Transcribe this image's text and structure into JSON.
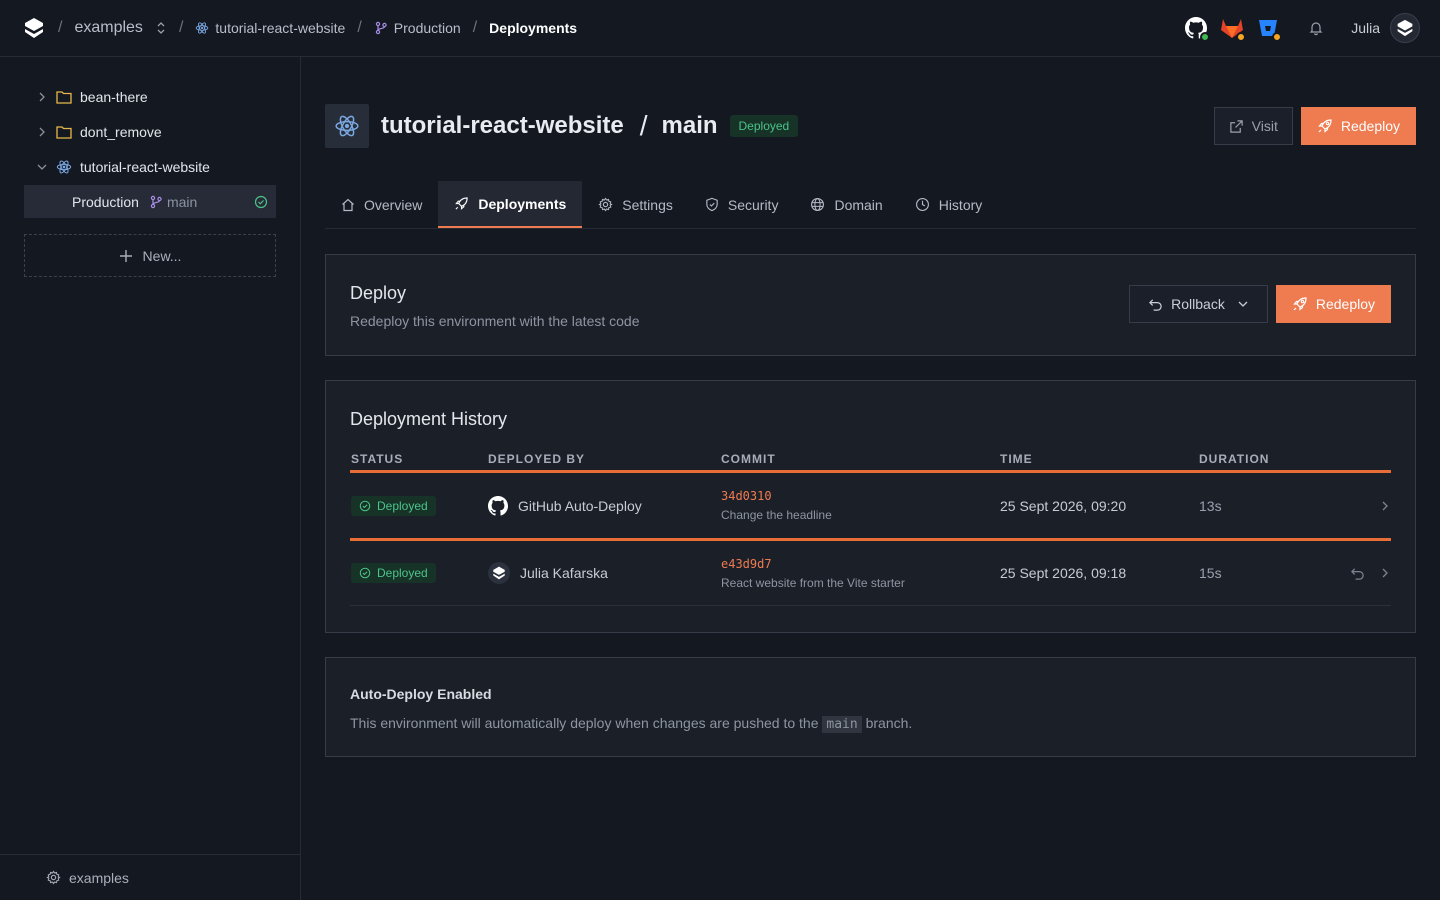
{
  "topbar": {
    "org": "examples",
    "project": "tutorial-react-website",
    "environment": "Production",
    "page": "Deployments",
    "user": "Julia",
    "icons": [
      "github-icon",
      "gitlab-icon",
      "bitbucket-icon",
      "bell-icon"
    ],
    "status_colors": {
      "github": "#3fb950",
      "gitlab": "#f5a623",
      "bitbucket": "#f5a623"
    }
  },
  "sidebar": {
    "items": [
      {
        "label": "bean-there",
        "icon": "folder-icon"
      },
      {
        "label": "dont_remove",
        "icon": "folder-icon"
      },
      {
        "label": "tutorial-react-website",
        "icon": "react-icon"
      }
    ],
    "child": {
      "label": "Production",
      "branch": "main"
    },
    "new_label": "New...",
    "footer_label": "examples"
  },
  "header": {
    "project": "tutorial-react-website",
    "slash": "/",
    "branch": "main",
    "status": "Deployed",
    "visit_label": "Visit",
    "redeploy_label": "Redeploy"
  },
  "tabs": [
    {
      "label": "Overview",
      "icon": "home-icon"
    },
    {
      "label": "Deployments",
      "icon": "rocket-icon",
      "active": true
    },
    {
      "label": "Settings",
      "icon": "gear-icon"
    },
    {
      "label": "Security",
      "icon": "shield-icon"
    },
    {
      "label": "Domain",
      "icon": "globe-icon"
    },
    {
      "label": "History",
      "icon": "clock-icon"
    }
  ],
  "deploy": {
    "title": "Deploy",
    "subtitle": "Redeploy this environment with the latest code",
    "rollback_label": "Rollback",
    "redeploy_label": "Redeploy"
  },
  "history": {
    "title": "Deployment History",
    "columns": [
      "STATUS",
      "DEPLOYED BY",
      "COMMIT",
      "TIME",
      "DURATION"
    ],
    "rows": [
      {
        "status": "Deployed",
        "by": "GitHub Auto-Deploy",
        "hash": "34d0310",
        "message": "Change the headline",
        "time": "25 Sept 2026, 09:20",
        "duration": "13s"
      },
      {
        "status": "Deployed",
        "by": "Julia Kafarska",
        "hash": "e43d9d7",
        "message": "React website from the Vite starter",
        "time": "25 Sept 2026, 09:18",
        "duration": "15s"
      }
    ]
  },
  "auto_deploy": {
    "title": "Auto-Deploy Enabled",
    "text_before": "This environment will automatically deploy when changes are pushed to the",
    "branch": "main",
    "text_after": "branch."
  },
  "colors": {
    "accent": "#ef7b51",
    "success": "#4cc38a",
    "background": "#141821"
  }
}
